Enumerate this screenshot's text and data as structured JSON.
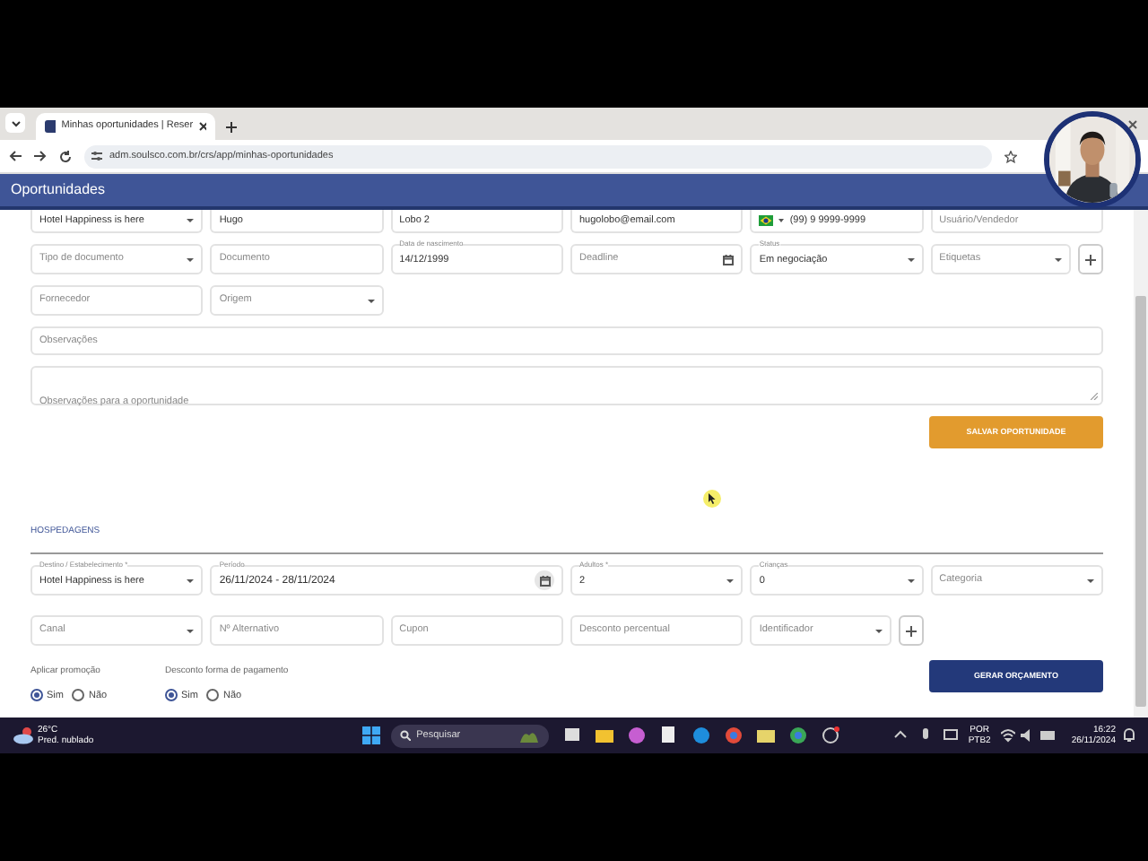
{
  "browser": {
    "tab_title": "Minhas oportunidades | Reser",
    "address": "adm.soulsco.com.br/crs/app/minhas-oportunidades"
  },
  "header": {
    "title": "Oportunidades"
  },
  "form": {
    "rows": [
      {
        "fields": [
          {
            "kind": "select",
            "value": "Hotel Happiness is here"
          },
          {
            "kind": "text",
            "value": "Hugo"
          },
          {
            "kind": "text",
            "value": "Lobo 2"
          },
          {
            "kind": "text",
            "value": "hugolobo@email.com"
          },
          {
            "kind": "phone",
            "value": "(99) 9 9999-9999"
          },
          {
            "kind": "text",
            "placeholder": "Usuário/Vendedor"
          }
        ]
      },
      {
        "fields": [
          {
            "kind": "select",
            "placeholder": "Tipo de documento"
          },
          {
            "kind": "text",
            "placeholder": "Documento"
          },
          {
            "kind": "text",
            "label": "Data de nascimento",
            "value": "14/12/1999"
          },
          {
            "kind": "date",
            "placeholder": "Deadline"
          },
          {
            "kind": "select",
            "label": "Status",
            "value": "Em negociação"
          },
          {
            "kind": "select",
            "placeholder": "Etiquetas",
            "addable": true
          }
        ]
      },
      {
        "fields": [
          {
            "kind": "text",
            "placeholder": "Fornecedor"
          },
          {
            "kind": "select",
            "placeholder": "Origem"
          }
        ]
      }
    ],
    "notes": {
      "placeholder": "Observações"
    },
    "opportunity_notes": {
      "placeholder": "Observações para a oportunidade"
    },
    "save_button": "SALVAR OPORTUNIDADE"
  },
  "lodging": {
    "title": "HOSPEDAGENS",
    "rows": [
      {
        "fields": [
          {
            "kind": "select",
            "label": "Destino / Estabelecimento *",
            "value": "Hotel Happiness is here"
          },
          {
            "kind": "daterange",
            "label": "Período",
            "value": "26/11/2024 - 28/11/2024"
          },
          {
            "kind": "select",
            "label": "Adultos *",
            "value": "2"
          },
          {
            "kind": "select",
            "label": "Crianças",
            "value": "0"
          },
          {
            "kind": "select",
            "placeholder": "Categoria"
          }
        ]
      },
      {
        "fields": [
          {
            "kind": "select",
            "placeholder": "Canal"
          },
          {
            "kind": "text",
            "placeholder": "Nº Alternativo"
          },
          {
            "kind": "text",
            "placeholder": "Cupon"
          },
          {
            "kind": "text",
            "placeholder": "Desconto percentual"
          },
          {
            "kind": "select",
            "placeholder": "Identificador",
            "addable": true
          }
        ]
      }
    ],
    "radio_groups": [
      {
        "label": "Aplicar promoção",
        "options": [
          {
            "label": "Sim",
            "selected": true
          },
          {
            "label": "Não",
            "selected": false
          }
        ]
      },
      {
        "label": "Desconto forma de pagamento",
        "options": [
          {
            "label": "Sim",
            "selected": true
          },
          {
            "label": "Não",
            "selected": false
          }
        ]
      }
    ],
    "quote_button": "GERAR ORÇAMENTO"
  },
  "taskbar": {
    "temperature": "26°C",
    "weather": "Pred. nublado",
    "search_placeholder": "Pesquisar",
    "language": "POR",
    "layout": "PTB2",
    "time": "16:22",
    "date": "26/11/2024"
  }
}
